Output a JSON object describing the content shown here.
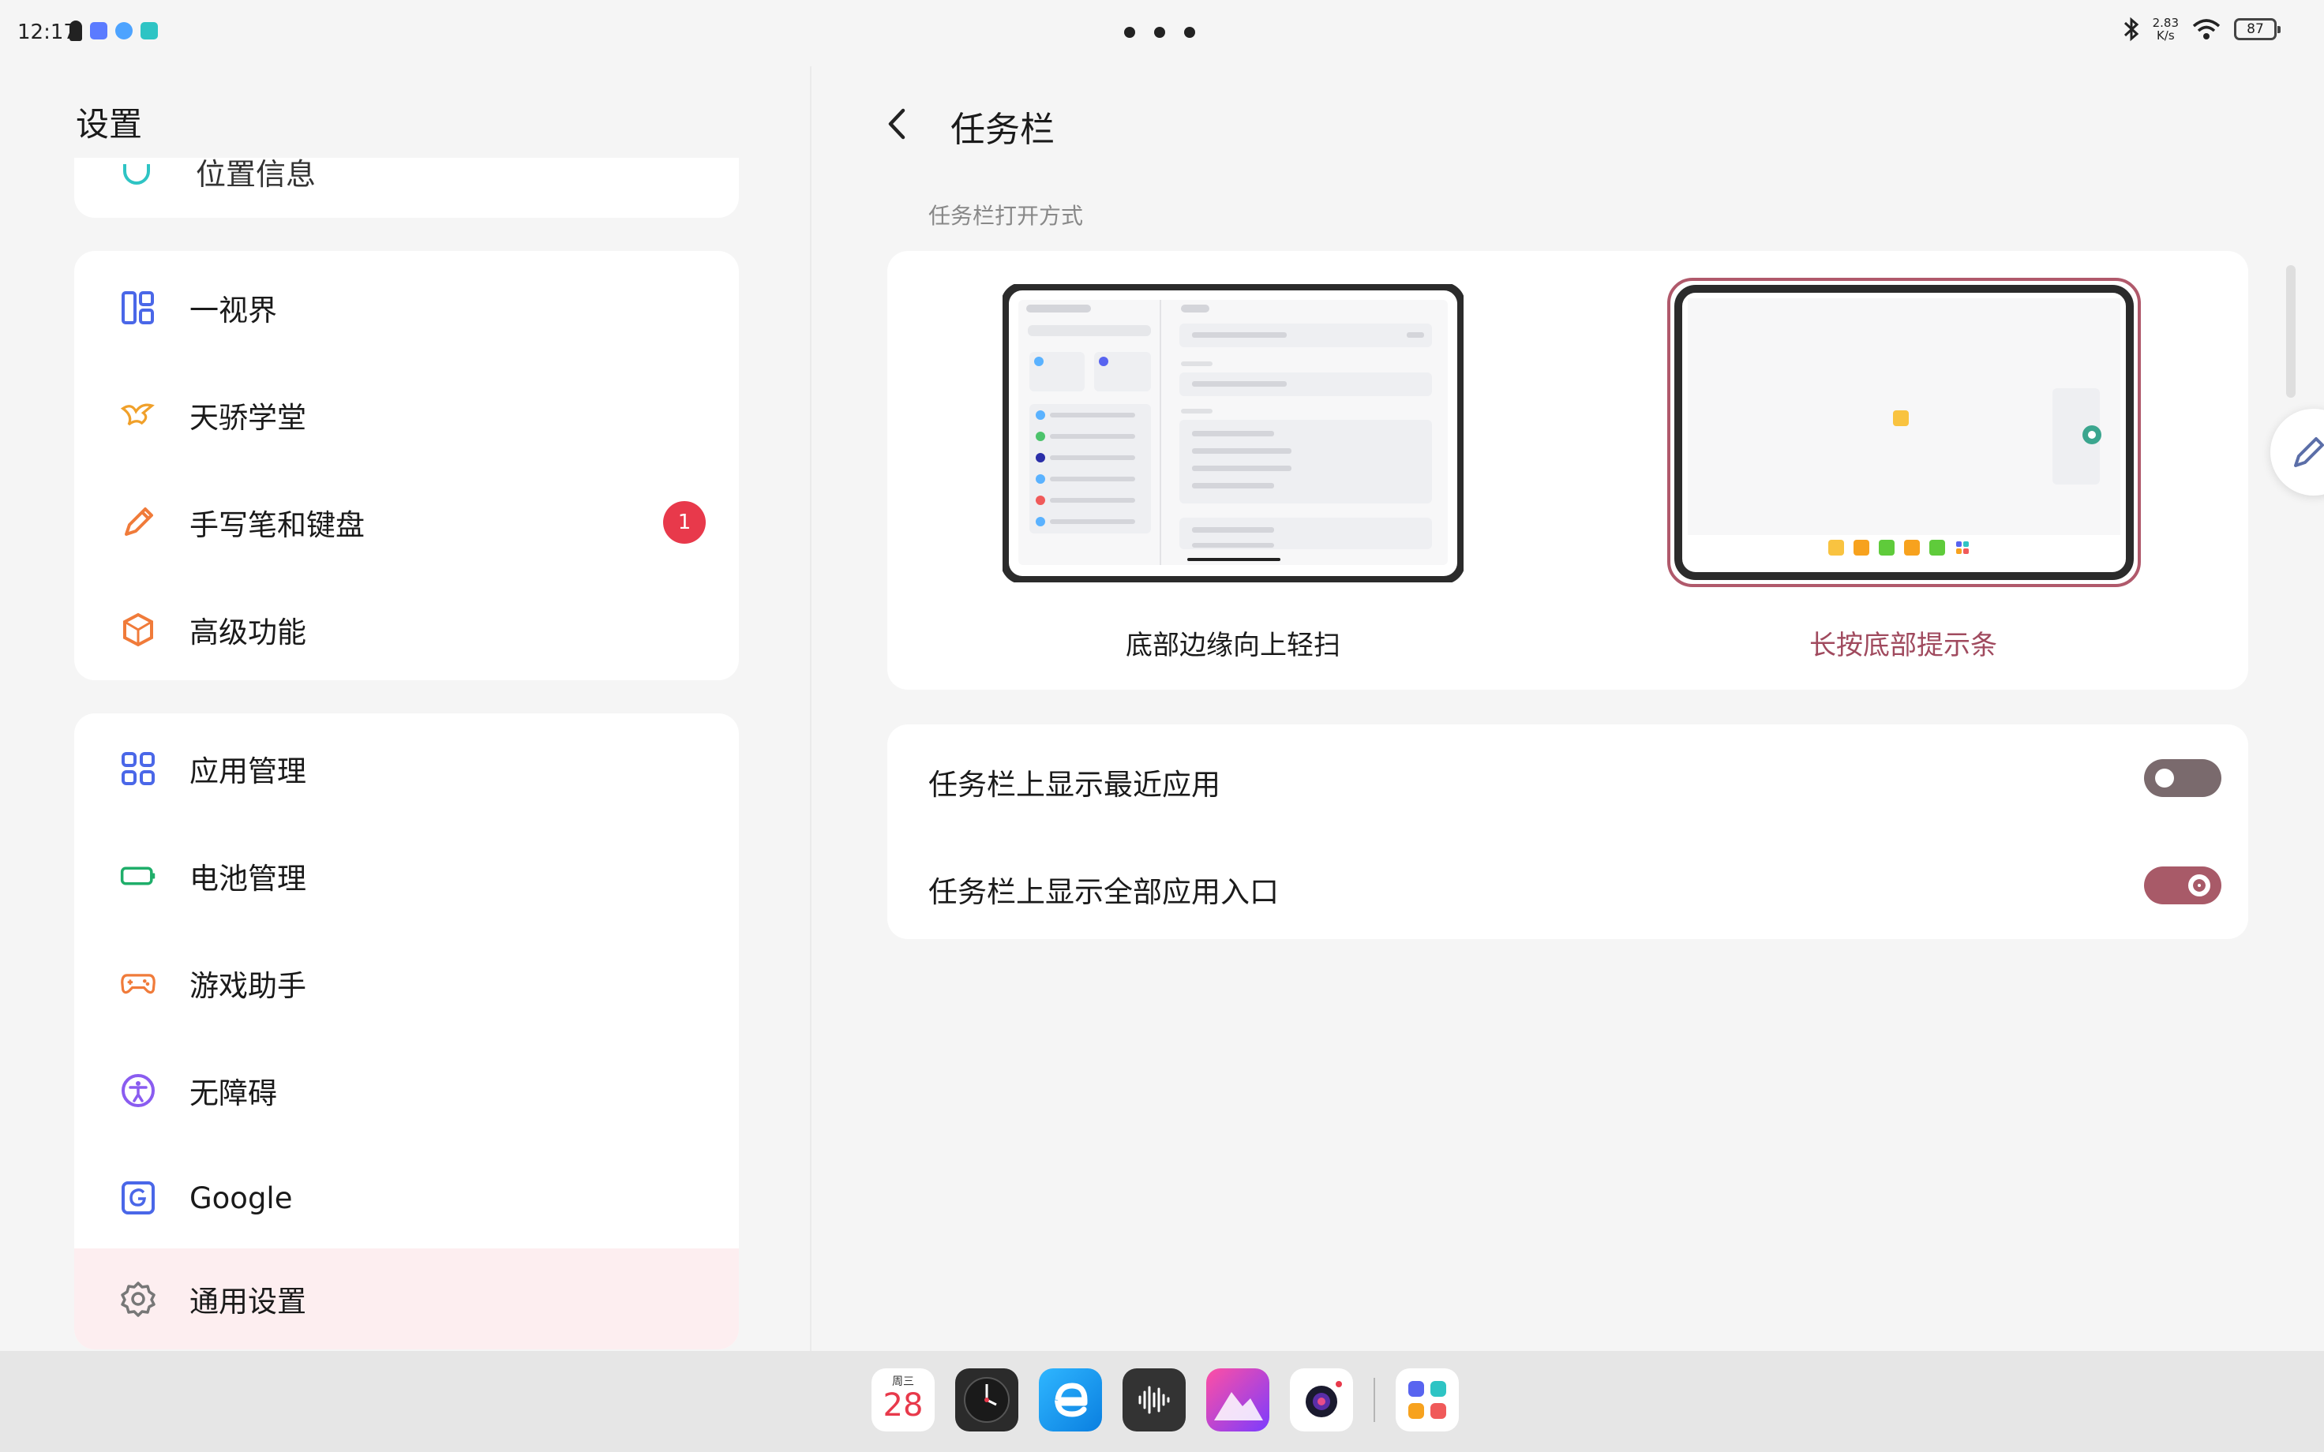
{
  "status_bar": {
    "time": "12:17",
    "net_speed_value": "2.83",
    "net_speed_unit": "K/s",
    "battery": "87"
  },
  "settings": {
    "title": "设置",
    "peek_item": "位置信息",
    "group_a": [
      {
        "label": "一视界",
        "icon": "grid-view-icon"
      },
      {
        "label": "天骄学堂",
        "icon": "learning-icon"
      },
      {
        "label": "手写笔和键盘",
        "icon": "pen-icon",
        "badge": "1"
      },
      {
        "label": "高级功能",
        "icon": "hexagon-icon"
      }
    ],
    "group_b": [
      {
        "label": "应用管理",
        "icon": "apps-icon"
      },
      {
        "label": "电池管理",
        "icon": "battery-icon"
      },
      {
        "label": "游戏助手",
        "icon": "gamepad-icon"
      },
      {
        "label": "无障碍",
        "icon": "accessibility-icon"
      },
      {
        "label": "Google",
        "icon": "google-icon"
      },
      {
        "label": "通用设置",
        "icon": "gear-icon",
        "selected": true
      }
    ]
  },
  "detail": {
    "title": "任务栏",
    "section_label": "任务栏打开方式",
    "option_swipe": "底部边缘向上轻扫",
    "option_longpress": "长按底部提示条",
    "selected_option": "option_longpress",
    "toggles": [
      {
        "label": "任务栏上显示最近应用",
        "on": false
      },
      {
        "label": "任务栏上显示全部应用入口",
        "on": true
      }
    ]
  },
  "dock": {
    "calendar_weekday": "周三",
    "calendar_date": "28",
    "apps": [
      "calendar-icon",
      "clock-icon",
      "browser-icon",
      "recorder-icon",
      "gallery-icon",
      "camera-icon",
      "all-apps-icon"
    ]
  },
  "colors": {
    "accent": "#a04a5e",
    "selected_bg": "#fdeef0",
    "badge": "#e8394b"
  }
}
